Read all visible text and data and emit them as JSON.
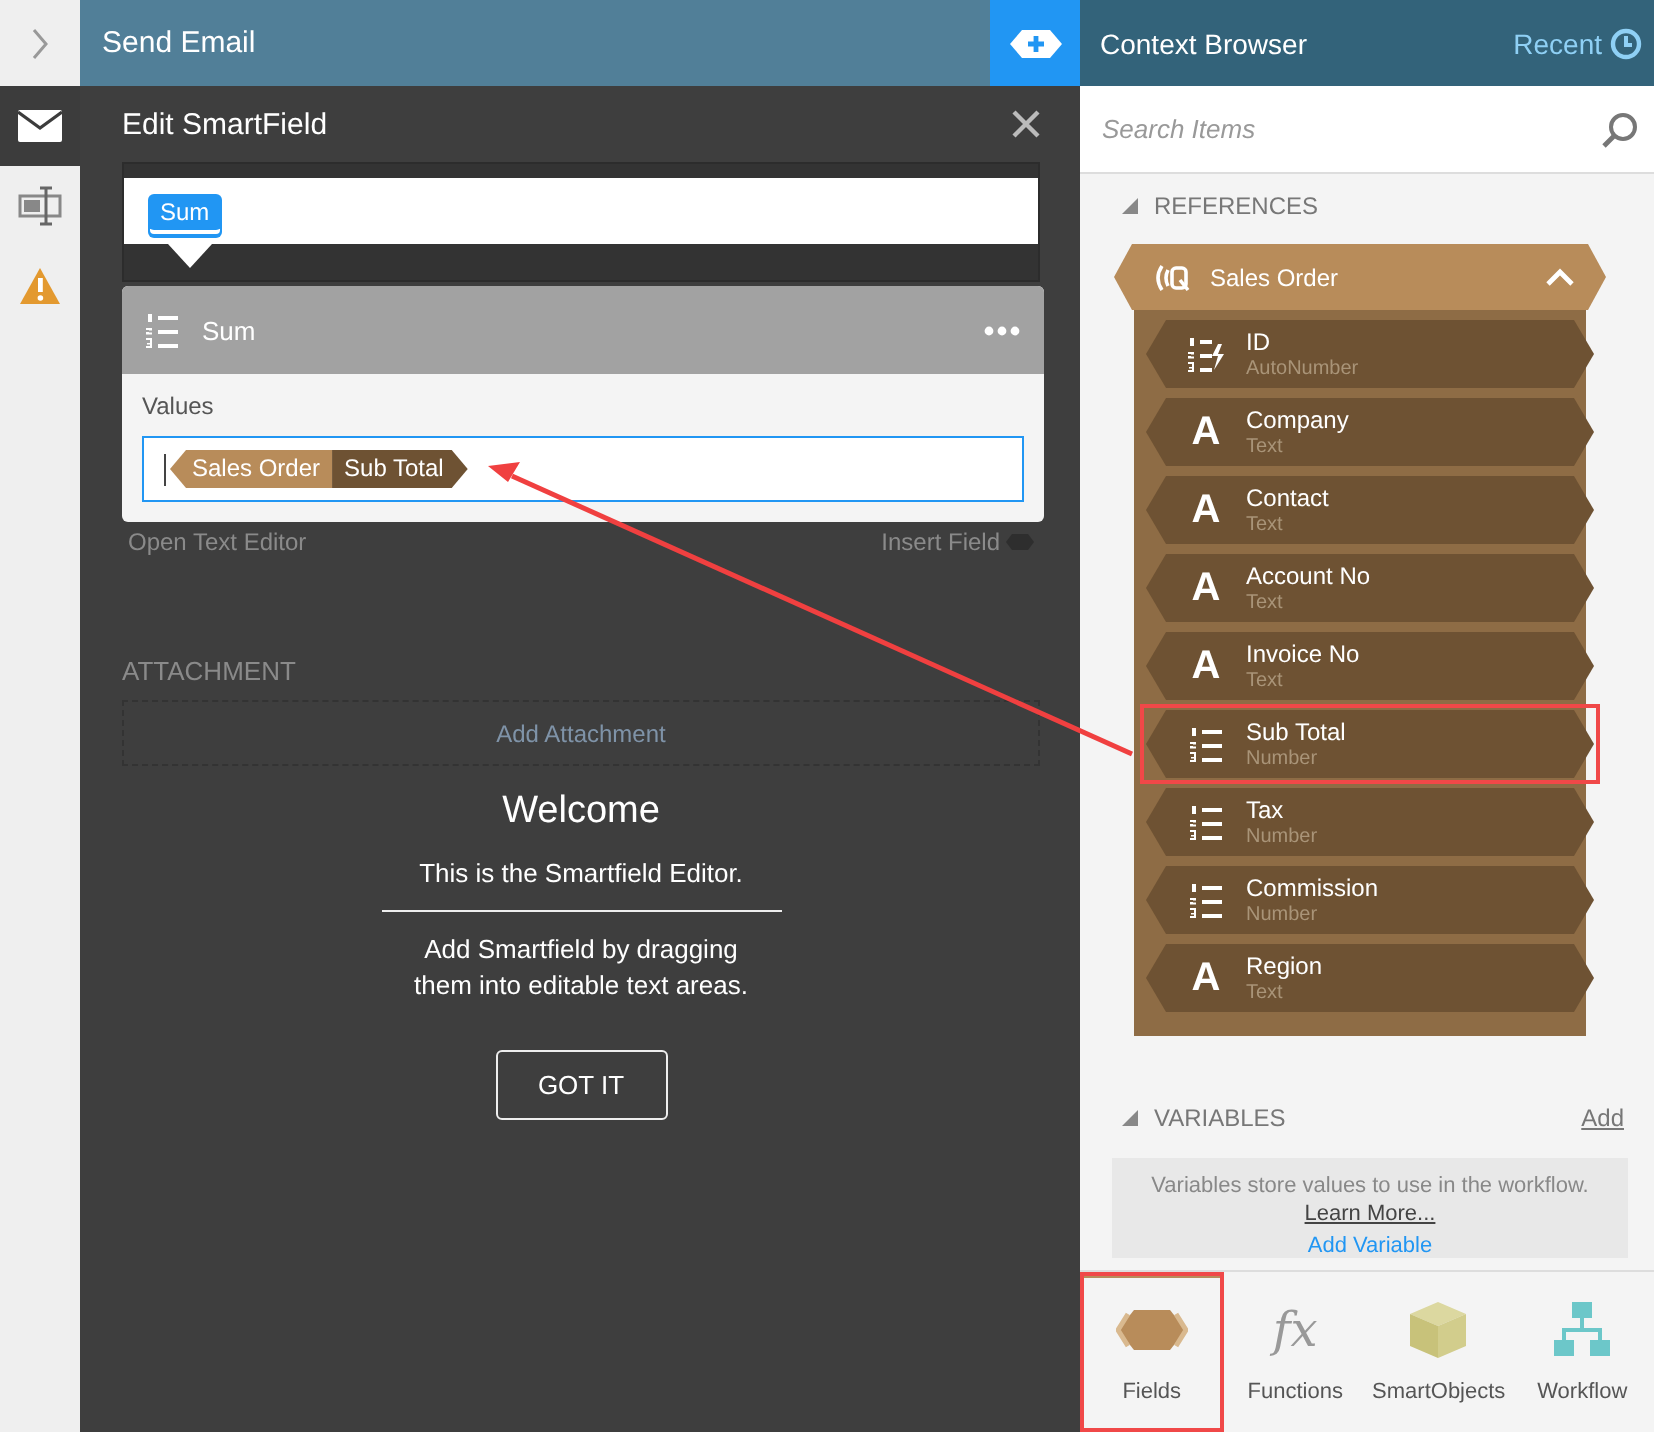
{
  "sidebar": {
    "items": [
      {
        "kind": "mail",
        "selected": true
      },
      {
        "kind": "form",
        "selected": false
      },
      {
        "kind": "warning",
        "selected": false
      }
    ]
  },
  "main": {
    "title": "Send Email",
    "open_text_editor": "Open Text Editor",
    "insert_field": "Insert Field",
    "attachment_label": "ATTACHMENT",
    "add_attachment": "Add Attachment"
  },
  "dialog": {
    "title": "Edit SmartField",
    "tokens": [
      {
        "label": "Sum",
        "selected": true
      }
    ],
    "function_name": "Sum",
    "values_label": "Values",
    "value_tokens": [
      {
        "label": "Sales Order",
        "kind": "parent"
      },
      {
        "label": "Sub Total",
        "kind": "field"
      }
    ]
  },
  "welcome": {
    "title": "Welcome",
    "line1": "This is the Smartfield Editor.",
    "line2": "Add Smartfield by dragging them into editable text areas.",
    "button": "GOT IT"
  },
  "context_browser": {
    "title": "Context Browser",
    "recent": "Recent",
    "search": {
      "placeholder": "Search Items"
    },
    "references": {
      "label": "REFERENCES",
      "expanded": true,
      "groups": [
        {
          "name": "Sales Order",
          "expanded": true,
          "fields": [
            {
              "name": "ID",
              "type": "AutoNumber",
              "kind": "autonumber",
              "highlighted": false
            },
            {
              "name": "Company",
              "type": "Text",
              "kind": "text",
              "glyph": "A",
              "highlighted": false
            },
            {
              "name": "Contact",
              "type": "Text",
              "kind": "text",
              "glyph": "A",
              "highlighted": false
            },
            {
              "name": "Account No",
              "type": "Text",
              "kind": "text",
              "glyph": "A",
              "highlighted": false
            },
            {
              "name": "Invoice No",
              "type": "Text",
              "kind": "text",
              "glyph": "A",
              "highlighted": false
            },
            {
              "name": "Sub Total",
              "type": "Number",
              "kind": "number",
              "highlighted": true
            },
            {
              "name": "Tax",
              "type": "Number",
              "kind": "number",
              "highlighted": false
            },
            {
              "name": "Commission",
              "type": "Number",
              "kind": "number",
              "highlighted": false
            },
            {
              "name": "Region",
              "type": "Text",
              "kind": "text",
              "glyph": "A",
              "highlighted": false
            }
          ]
        }
      ]
    },
    "variables": {
      "label": "VARIABLES",
      "expanded": true,
      "add": "Add",
      "info": "Variables store values to use in the workflow.",
      "learn_more": "Learn More...",
      "add_variable": "Add Variable"
    }
  },
  "bottom_tabs": [
    {
      "label": "Fields",
      "kind": "fields",
      "selected": true,
      "highlighted": true
    },
    {
      "label": "Functions",
      "kind": "functions",
      "glyph": "fx",
      "selected": false,
      "highlighted": false
    },
    {
      "label": "SmartObjects",
      "kind": "smartobjects",
      "selected": false,
      "highlighted": false
    },
    {
      "label": "Workflow",
      "kind": "workflow",
      "selected": false,
      "highlighted": false
    }
  ]
}
